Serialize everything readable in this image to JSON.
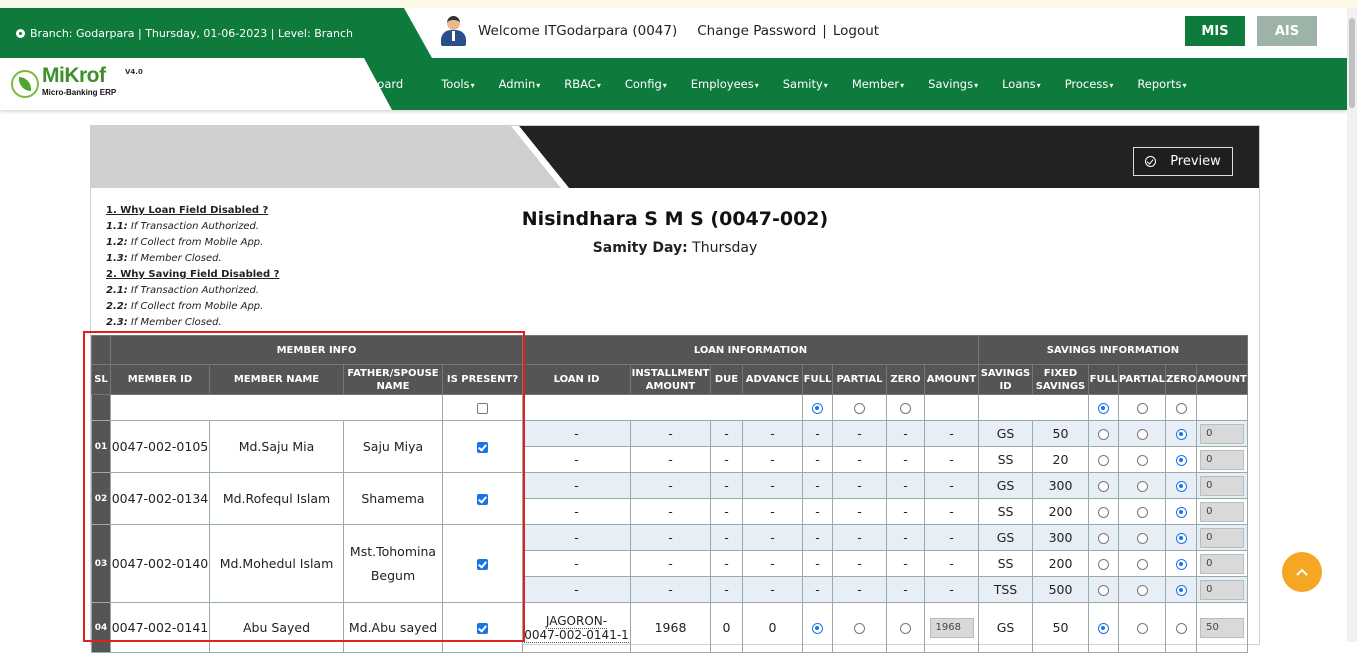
{
  "header": {
    "branch_info": "Branch: Godarpara | Thursday, 01-06-2023 | Level: Branch",
    "welcome": "Welcome ITGodarpara (0047)",
    "change_password": "Change Password",
    "separator": "|",
    "logout": "Logout",
    "mis_button": "MIS",
    "ais_button": "AIS"
  },
  "logo": {
    "name_a": "Mi",
    "name_b": "Krof",
    "version": "V4.0",
    "subtitle": "Micro-Banking ERP"
  },
  "menu": [
    "board",
    "Tools",
    "Admin",
    "RBAC",
    "Config",
    "Employees",
    "Samity",
    "Member",
    "Savings",
    "Loans",
    "Process",
    "Reports"
  ],
  "panel": {
    "preview_label": "Preview"
  },
  "notes": {
    "h1": "1. Why Loan Field Disabled ?",
    "n11_k": "1.1:",
    "n11_v": " If Transaction Authorized.",
    "n12_k": "1.2:",
    "n12_v": " If Collect from Mobile App.",
    "n13_k": "1.3:",
    "n13_v": " If Member Closed.",
    "h2": "2. Why Saving Field Disabled ?",
    "n21_k": "2.1:",
    "n21_v": " If Transaction Authorized.",
    "n22_k": "2.2:",
    "n22_v": " If Collect from Mobile App.",
    "n23_k": "2.3:",
    "n23_v": " If Member Closed."
  },
  "samity": {
    "title": "Nisindhara S M S (0047-002)",
    "day_label": "Samity Day:",
    "day_value": " Thursday"
  },
  "table": {
    "group_member": "MEMBER INFO",
    "group_loan": "LOAN INFORMATION",
    "group_savings": "SAVINGS INFORMATION",
    "col_sl": "SL",
    "col_member_id": "MEMBER ID",
    "col_member_name": "MEMBER NAME",
    "col_father": "FATHER/SPOUSE NAME",
    "col_present": "IS PRESENT?",
    "col_loan_id": "LOAN ID",
    "col_installment": "INSTALLMENT AMOUNT",
    "col_due": "DUE",
    "col_advance": "ADVANCE",
    "col_full": "FULL",
    "col_partial": "PARTIAL",
    "col_zero": "ZERO",
    "col_amount": "AMOUNT",
    "col_savings_id": "SAVINGS ID",
    "col_fixed": "FIXED SAVINGS",
    "dash": "-",
    "members": [
      {
        "sl": "01",
        "id": "0047-002-0105",
        "name": "Md.Saju Mia",
        "father": "Saju Miya",
        "present": true,
        "rows": [
          {
            "sav": "GS",
            "fixed": "50",
            "amt": "0"
          },
          {
            "sav": "SS",
            "fixed": "20",
            "amt": "0"
          }
        ]
      },
      {
        "sl": "02",
        "id": "0047-002-0134",
        "name": "Md.Rofequl Islam",
        "father": "Shamema",
        "present": true,
        "rows": [
          {
            "sav": "GS",
            "fixed": "300",
            "amt": "0"
          },
          {
            "sav": "SS",
            "fixed": "200",
            "amt": "0"
          }
        ]
      },
      {
        "sl": "03",
        "id": "0047-002-0140",
        "name": "Md.Mohedul Islam",
        "father": "Mst.Tohomina Begum",
        "present": true,
        "rows": [
          {
            "sav": "GS",
            "fixed": "300",
            "amt": "0"
          },
          {
            "sav": "SS",
            "fixed": "200",
            "amt": "0"
          },
          {
            "sav": "TSS",
            "fixed": "500",
            "amt": "0"
          }
        ]
      },
      {
        "sl": "04",
        "id": "0047-002-0141",
        "name": "Abu Sayed",
        "father": "Md.Abu sayed",
        "present": true,
        "loan_id_a": "JAGORON-",
        "loan_id_b": "0047-002-0141-1",
        "installment": "1968",
        "due": "0",
        "advance": "0",
        "loan_amt": "1968",
        "rows": [
          {
            "sav": "GS",
            "fixed": "50",
            "amt": "50"
          }
        ]
      }
    ]
  },
  "colors": {
    "brand_green": "#0e7a3c",
    "header_gray": "#555555",
    "highlight_red": "#e02020",
    "scroll_top": "#f5a623"
  }
}
